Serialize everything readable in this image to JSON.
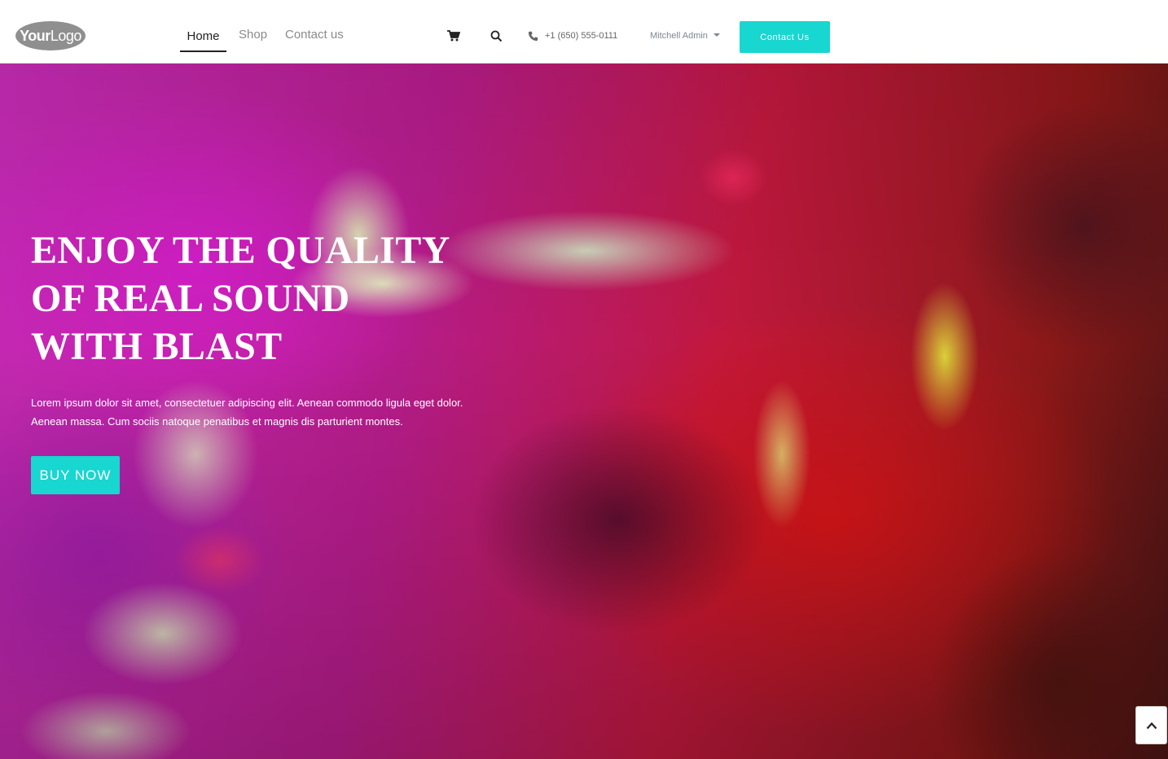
{
  "header": {
    "logo": {
      "part1": "Your",
      "part2": "Logo"
    },
    "nav": [
      {
        "label": "Home",
        "active": true
      },
      {
        "label": "Shop",
        "active": false
      },
      {
        "label": "Contact us",
        "active": false
      }
    ],
    "icons": {
      "cart": "shopping-cart-icon",
      "search": "search-icon",
      "phone": "phone-icon"
    },
    "phone": "+1 (650) 555-0111",
    "user": "Mitchell Admin",
    "contact_button": "Contact Us"
  },
  "hero": {
    "title_lines": [
      "ENJOY THE QUALITY",
      "OF REAL SOUND",
      "WITH BLAST"
    ],
    "text": "Lorem ipsum dolor sit amet, consectetuer adipiscing elit. Aenean commodo ligula eget dolor. Aenean massa. Cum sociis natoque penatibus et magnis dis parturient montes.",
    "cta": "BUY NOW"
  },
  "colors": {
    "accent": "#18d6d0",
    "header_bg": "#ffffff",
    "nav_active": "#222222",
    "nav_inactive": "#8a8a8a"
  },
  "scroll_top_icon": "chevron-up-icon"
}
